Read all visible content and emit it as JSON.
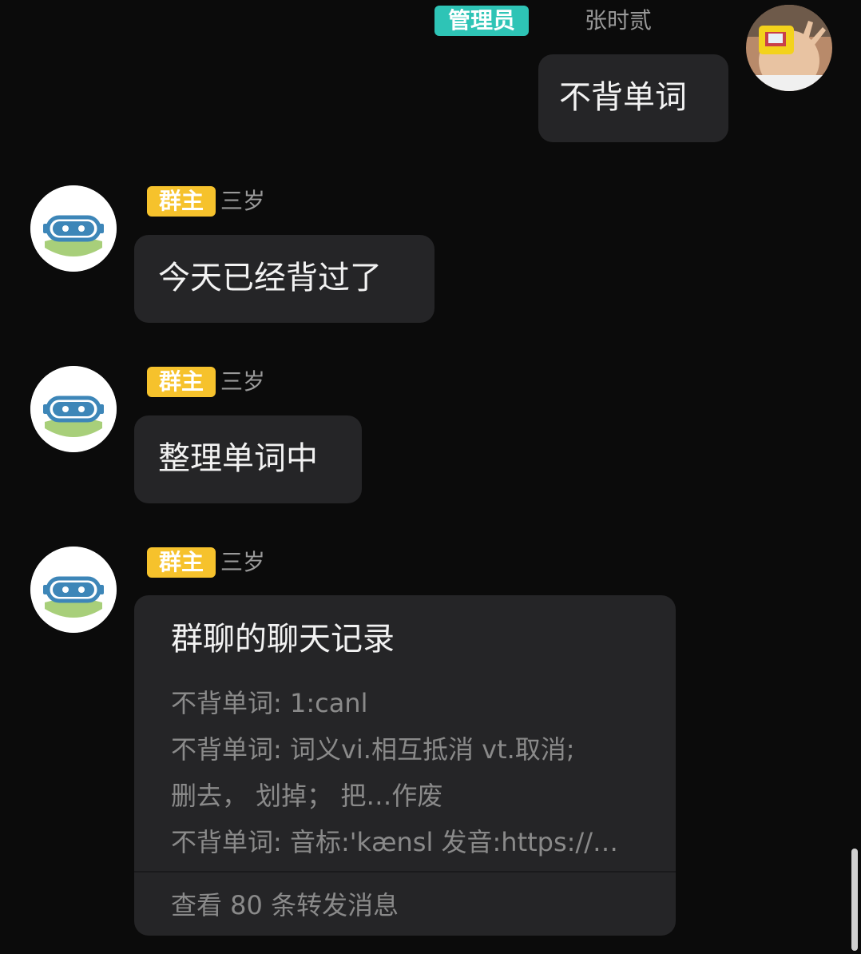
{
  "self_message": {
    "badge": "管理员",
    "name": "张时贰",
    "text": "不背单词",
    "badge_color": "#2ec4b6"
  },
  "bot_messages": [
    {
      "badge": "群主",
      "name": "三岁",
      "text": "今天已经背过了"
    },
    {
      "badge": "群主",
      "name": "三岁",
      "text": "整理单词中"
    },
    {
      "badge": "群主",
      "name": "三岁"
    }
  ],
  "forward_card": {
    "title": "群聊的聊天记录",
    "lines": [
      "不背单词: 1:canl",
      "不背单词: 词义vi.相互抵消 vt.取消;",
      "删去， 划掉； 把…作废",
      "不背单词: 音标:'kænsl 发音:https://…"
    ],
    "footer": "查看 80 条转发消息"
  },
  "colors": {
    "background": "#0b0b0b",
    "bubble": "#252527",
    "owner_badge": "#f6c22c",
    "admin_badge": "#2ec4b6"
  },
  "icons": {
    "self_avatar": "user-photo-avatar",
    "bot_avatar": "robot-face-icon"
  }
}
